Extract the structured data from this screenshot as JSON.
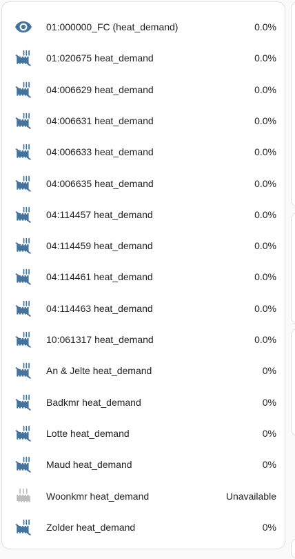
{
  "accent_color": "#44739e",
  "unavailable_color": "#bdbdbd",
  "entities": [
    {
      "name": "01:000000_FC (heat_demand)",
      "value": "0.0%",
      "icon": "eye-icon"
    },
    {
      "name": "01:020675 heat_demand",
      "value": "0.0%",
      "icon": "radiator-off-icon"
    },
    {
      "name": "04:006629 heat_demand",
      "value": "0.0%",
      "icon": "radiator-off-icon"
    },
    {
      "name": "04:006631 heat_demand",
      "value": "0.0%",
      "icon": "radiator-off-icon"
    },
    {
      "name": "04:006633 heat_demand",
      "value": "0.0%",
      "icon": "radiator-off-icon"
    },
    {
      "name": "04:006635 heat_demand",
      "value": "0.0%",
      "icon": "radiator-off-icon"
    },
    {
      "name": "04:114457 heat_demand",
      "value": "0.0%",
      "icon": "radiator-off-icon"
    },
    {
      "name": "04:114459 heat_demand",
      "value": "0.0%",
      "icon": "radiator-off-icon"
    },
    {
      "name": "04:114461 heat_demand",
      "value": "0.0%",
      "icon": "radiator-off-icon"
    },
    {
      "name": "04:114463 heat_demand",
      "value": "0.0%",
      "icon": "radiator-off-icon"
    },
    {
      "name": "10:061317 heat_demand",
      "value": "0.0%",
      "icon": "radiator-off-icon"
    },
    {
      "name": "An & Jelte heat_demand",
      "value": "0%",
      "icon": "radiator-off-icon"
    },
    {
      "name": "Badkmr heat_demand",
      "value": "0%",
      "icon": "radiator-off-icon"
    },
    {
      "name": "Lotte heat_demand",
      "value": "0%",
      "icon": "radiator-off-icon"
    },
    {
      "name": "Maud heat_demand",
      "value": "0%",
      "icon": "radiator-off-icon"
    },
    {
      "name": "Woonkmr heat_demand",
      "value": "Unavailable",
      "icon": "radiator-icon"
    },
    {
      "name": "Zolder heat_demand",
      "value": "0%",
      "icon": "radiator-off-icon"
    }
  ]
}
